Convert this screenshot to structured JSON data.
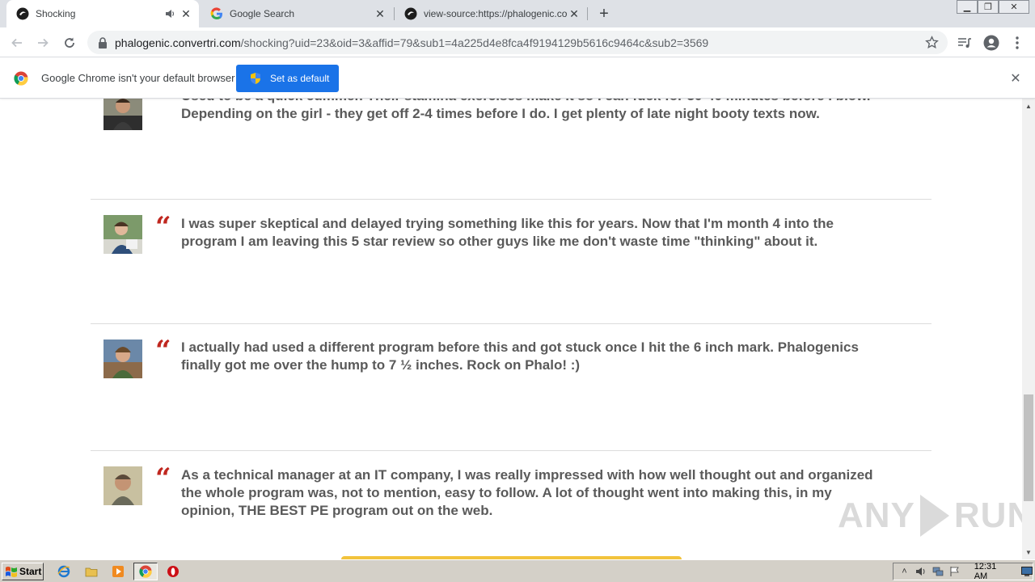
{
  "tabs": [
    {
      "title": "Shocking",
      "active": true,
      "audio": true
    },
    {
      "title": "Google Search",
      "active": false
    },
    {
      "title": "view-source:https://phalogenic.con",
      "active": false
    }
  ],
  "window_controls": {
    "minimize": "▁",
    "restore": "❐",
    "close": "✕"
  },
  "toolbar": {
    "url_host": "phalogenic.convertri.com",
    "url_rest": "/shocking?uid=23&oid=3&affid=79&sub1=4a225d4e8fca4f9194129b5616c9464c&sub2=3569"
  },
  "infobar": {
    "message": "Google Chrome isn't your default browser",
    "button_label": "Set as default",
    "close": "✕"
  },
  "reviews": [
    {
      "quote_mark": "“",
      "text": "Used to be a quick cummer. Their stamina exercises make it so I can fuck for 30-40 minutes before I blow. Depending on the girl - they get off 2-4 times before I do. I get plenty of late night booty texts now."
    },
    {
      "quote_mark": "“",
      "text": "I was super skeptical and delayed trying something like this for years. Now that I'm month 4 into the program I am leaving this 5 star review so other guys like me don't waste time \"thinking\" about it."
    },
    {
      "quote_mark": "“",
      "text": "I actually had used a different program before this and got stuck once I hit the 6 inch mark. Phalogenics finally got me over the hump to 7 ½ inches. Rock on Phalo! :)"
    },
    {
      "quote_mark": "“",
      "text": "As a technical manager at an IT company, I was really impressed with how well thought out and organized the whole program was, not to mention, easy to follow. A lot of thought went into making this, in my opinion, THE BEST PE program out on the web."
    }
  ],
  "watermark": {
    "left": "ANY",
    "right": "RUN"
  },
  "scrollbar": {
    "up": "▲",
    "down": "▼"
  },
  "taskbar": {
    "start_label": "Start",
    "clock": "12:31 AM"
  },
  "colors": {
    "accent": "#1a73e8",
    "quote": "#c0271f",
    "review_text": "#5a5a5a",
    "cta": "#f2c33c"
  }
}
